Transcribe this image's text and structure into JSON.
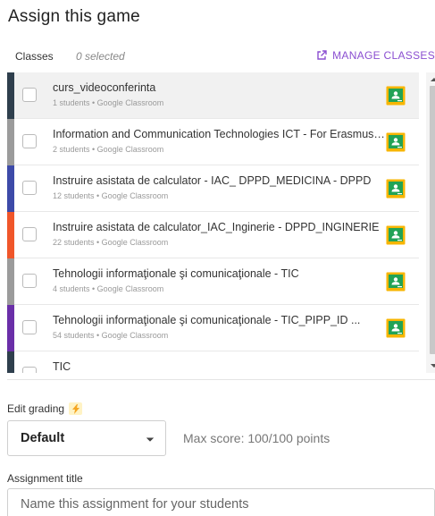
{
  "title": "Assign this game",
  "classes": {
    "label": "Classes",
    "selected_text": "0 selected",
    "manage_label": "MANAGE CLASSES",
    "accent_color": "#8b4fd1",
    "items": [
      {
        "name": "curs_videoconferinta",
        "meta": "1 students • Google Classroom",
        "color": "#2f3f4d"
      },
      {
        "name": "Information and Communication Technologies ICT - For Erasmus students",
        "meta": "2 students • Google Classroom",
        "color": "#9b9b9b"
      },
      {
        "name": "Instruire asistata de calculator - IAC_ DPPD_MEDICINA - DPPD",
        "meta": "12 students • Google Classroom",
        "color": "#3d4aa8"
      },
      {
        "name": "Instruire asistata de calculator_IAC_Inginerie - DPPD_INGINERIE",
        "meta": "22 students • Google Classroom",
        "color": "#f0562a"
      },
      {
        "name": "Tehnologii informaţionale şi comunicaţionale - TIC",
        "meta": "4 students • Google Classroom",
        "color": "#9b9b9b"
      },
      {
        "name": "Tehnologii informaţionale şi comunicaţionale - TIC_PIPP_ID ...",
        "meta": "54 students • Google Classroom",
        "color": "#6a2fa8"
      },
      {
        "name": "TIC",
        "meta": "",
        "color": "#2f3f4d"
      }
    ]
  },
  "grading": {
    "label": "Edit grading",
    "select_value": "Default",
    "max_score": "Max score: 100/100 points"
  },
  "assignment": {
    "label": "Assignment title",
    "placeholder": "Name this assignment for your students"
  }
}
